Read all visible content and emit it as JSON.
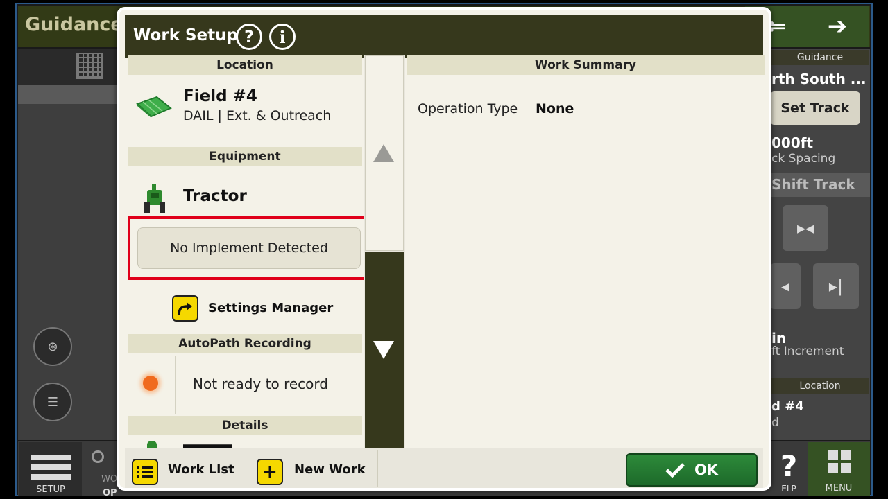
{
  "background": {
    "title": "Guidance",
    "right_panel": {
      "guidance_label": "Guidance",
      "track_name": "rth South ...",
      "set_track": "Set Track",
      "spacing_value": "000ft",
      "spacing_label": "ck Spacing",
      "shift_track": "Shift Track",
      "increment_value": "in",
      "increment_label": "ft Increment",
      "location_label": "Location",
      "location_value": "d #4",
      "location_sub": "d"
    },
    "bottom": {
      "setup_label": "SETUP",
      "menu_label": "MENU",
      "help_glyph": "?",
      "help_label": "ELP",
      "work_label": "WO",
      "op_label": "OP"
    },
    "nav_arrow_left": "⇐",
    "nav_arrow_right": "➔"
  },
  "dialog": {
    "title": "Work Setup",
    "help_glyph": "?",
    "info_glyph": "i",
    "location": {
      "header": "Location",
      "field_name": "Field #4",
      "field_sub": "DAIL | Ext. & Outreach"
    },
    "equipment": {
      "header": "Equipment",
      "tractor": "Tractor",
      "implement_button": "No Implement Detected",
      "settings_manager": "Settings Manager"
    },
    "autopath": {
      "header": "AutoPath Recording",
      "status": "Not ready to record"
    },
    "details": {
      "header": "Details"
    },
    "work_summary": {
      "header": "Work Summary",
      "operation_type_label": "Operation Type",
      "operation_type_value": "None"
    },
    "footer": {
      "work_list": "Work List",
      "new_work": "New Work",
      "new_work_glyph": "+",
      "ok": "OK"
    }
  },
  "colors": {
    "header_dark": "#36381c",
    "section_header": "#e2e0c8",
    "highlight_red": "#e0001a",
    "accent_yellow": "#f5d800",
    "ok_green": "#2d8a3a",
    "status_orange": "#f06a1e"
  },
  "icons": {
    "field": "field-map-icon",
    "tractor": "tractor-icon",
    "settings": "arrow-curve-icon",
    "work_list": "list-icon",
    "new_work": "plus-icon",
    "ok": "checkmark-icon",
    "help": "question-icon",
    "info": "info-icon"
  }
}
